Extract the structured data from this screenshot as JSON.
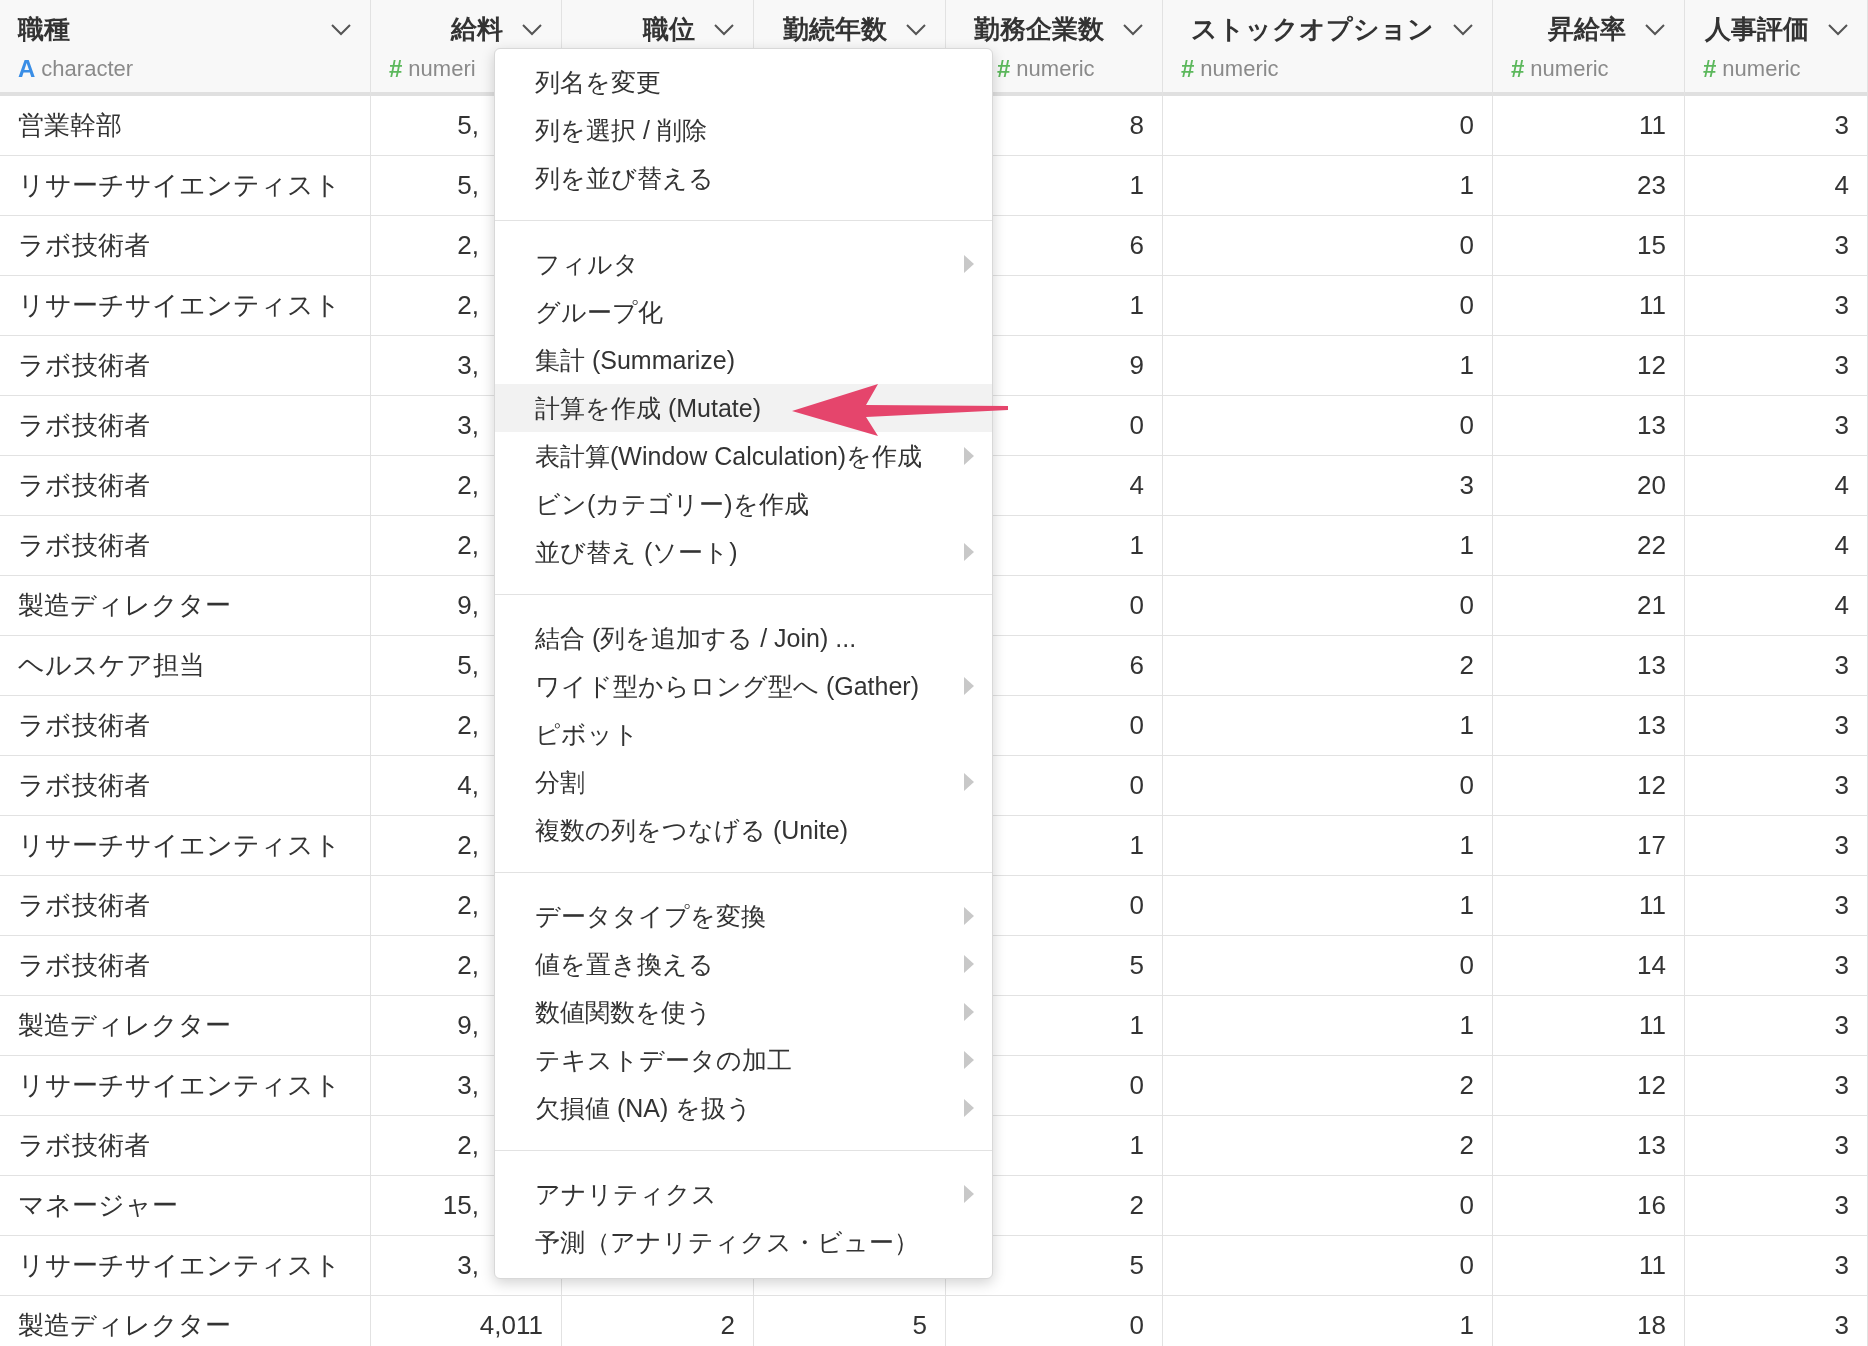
{
  "table": {
    "columns": [
      {
        "title": "職種",
        "kind": "character",
        "type_icon": "A",
        "type_label": "character"
      },
      {
        "title": "給料",
        "kind": "numeric",
        "type_icon": "#",
        "type_label": "numeri"
      },
      {
        "title": "職位",
        "kind": "numeric"
      },
      {
        "title": "勤続年数",
        "kind": "numeric"
      },
      {
        "title": "勤務企業数",
        "kind": "numeric",
        "type_icon": "#",
        "type_label": "numeric"
      },
      {
        "title": "ストックオプション",
        "kind": "numeric",
        "type_icon": "#",
        "type_label": "numeric"
      },
      {
        "title": "昇給率",
        "kind": "numeric",
        "type_icon": "#",
        "type_label": "numeric"
      },
      {
        "title": "人事評価",
        "kind": "numeric",
        "type_icon": "#",
        "type_label": "numeric"
      }
    ],
    "rows": [
      [
        "営業幹部",
        "5,",
        null,
        null,
        "8",
        "0",
        "11",
        "3"
      ],
      [
        "リサーチサイエンティスト",
        "5,",
        null,
        null,
        "1",
        "1",
        "23",
        "4"
      ],
      [
        "ラボ技術者",
        "2,",
        null,
        null,
        "6",
        "0",
        "15",
        "3"
      ],
      [
        "リサーチサイエンティスト",
        "2,",
        null,
        null,
        "1",
        "0",
        "11",
        "3"
      ],
      [
        "ラボ技術者",
        "3,",
        null,
        null,
        "9",
        "1",
        "12",
        "3"
      ],
      [
        "ラボ技術者",
        "3,",
        null,
        null,
        "0",
        "0",
        "13",
        "3"
      ],
      [
        "ラボ技術者",
        "2,",
        null,
        null,
        "4",
        "3",
        "20",
        "4"
      ],
      [
        "ラボ技術者",
        "2,",
        null,
        null,
        "1",
        "1",
        "22",
        "4"
      ],
      [
        "製造ディレクター",
        "9,",
        null,
        null,
        "0",
        "0",
        "21",
        "4"
      ],
      [
        "ヘルスケア担当",
        "5,",
        null,
        null,
        "6",
        "2",
        "13",
        "3"
      ],
      [
        "ラボ技術者",
        "2,",
        null,
        null,
        "0",
        "1",
        "13",
        "3"
      ],
      [
        "ラボ技術者",
        "4,",
        null,
        null,
        "0",
        "0",
        "12",
        "3"
      ],
      [
        "リサーチサイエンティスト",
        "2,",
        null,
        null,
        "1",
        "1",
        "17",
        "3"
      ],
      [
        "ラボ技術者",
        "2,",
        null,
        null,
        "0",
        "1",
        "11",
        "3"
      ],
      [
        "ラボ技術者",
        "2,",
        null,
        null,
        "5",
        "0",
        "14",
        "3"
      ],
      [
        "製造ディレクター",
        "9,",
        null,
        null,
        "1",
        "1",
        "11",
        "3"
      ],
      [
        "リサーチサイエンティスト",
        "3,",
        null,
        null,
        "0",
        "2",
        "12",
        "3"
      ],
      [
        "ラボ技術者",
        "2,",
        null,
        null,
        "1",
        "2",
        "13",
        "3"
      ],
      [
        "マネージャー",
        "15,",
        null,
        null,
        "2",
        "0",
        "16",
        "3"
      ],
      [
        "リサーチサイエンティスト",
        "3,",
        null,
        null,
        "5",
        "0",
        "11",
        "3"
      ],
      [
        "製造ディレクター",
        "4,011",
        "2",
        "5",
        "0",
        "1",
        "18",
        "3"
      ]
    ]
  },
  "context_menu": {
    "groups": [
      [
        {
          "label": "列名を変更",
          "has_submenu": false,
          "selected": false
        },
        {
          "label": "列を選択 / 削除",
          "has_submenu": false,
          "selected": false
        },
        {
          "label": "列を並び替える",
          "has_submenu": false,
          "selected": false
        }
      ],
      [
        {
          "label": "フィルタ",
          "has_submenu": true,
          "selected": false
        },
        {
          "label": "グループ化",
          "has_submenu": false,
          "selected": false
        },
        {
          "label": "集計 (Summarize)",
          "has_submenu": false,
          "selected": false
        },
        {
          "label": "計算を作成 (Mutate)",
          "has_submenu": false,
          "selected": true
        },
        {
          "label": "表計算(Window Calculation)を作成",
          "has_submenu": true,
          "selected": false
        },
        {
          "label": "ビン(カテゴリー)を作成",
          "has_submenu": false,
          "selected": false
        },
        {
          "label": "並び替え (ソート)",
          "has_submenu": true,
          "selected": false
        }
      ],
      [
        {
          "label": "結合 (列を追加する / Join) ...",
          "has_submenu": false,
          "selected": false
        },
        {
          "label": "ワイド型からロング型へ (Gather)",
          "has_submenu": true,
          "selected": false
        },
        {
          "label": "ピボット",
          "has_submenu": false,
          "selected": false
        },
        {
          "label": "分割",
          "has_submenu": true,
          "selected": false
        },
        {
          "label": "複数の列をつなげる (Unite)",
          "has_submenu": false,
          "selected": false
        }
      ],
      [
        {
          "label": "データタイプを変換",
          "has_submenu": true,
          "selected": false
        },
        {
          "label": "値を置き換える",
          "has_submenu": true,
          "selected": false
        },
        {
          "label": "数値関数を使う",
          "has_submenu": true,
          "selected": false
        },
        {
          "label": "テキストデータの加工",
          "has_submenu": true,
          "selected": false
        },
        {
          "label": "欠損値 (NA) を扱う",
          "has_submenu": true,
          "selected": false
        }
      ],
      [
        {
          "label": "アナリティクス",
          "has_submenu": true,
          "selected": false
        },
        {
          "label": "予測（アナリティクス・ビュー）",
          "has_submenu": false,
          "selected": false
        }
      ]
    ]
  }
}
